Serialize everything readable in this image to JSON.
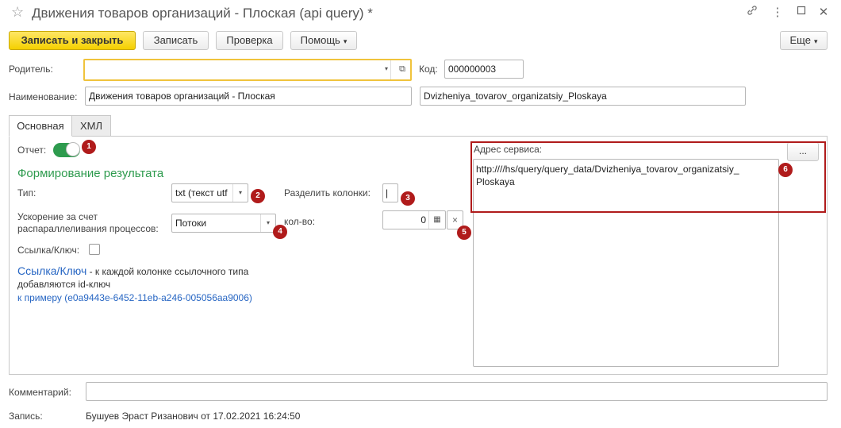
{
  "window": {
    "title": "Движения товаров организаций - Плоская (api query) *",
    "star_icon": "☆",
    "link_icon": "🔗",
    "menu_icon": "⋮",
    "min_icon": "▫",
    "close_icon": "✕"
  },
  "toolbar": {
    "save_close": "Записать и закрыть",
    "save": "Записать",
    "check": "Проверка",
    "help": "Помощь",
    "more": "Еще"
  },
  "header": {
    "parent_label": "Родитель:",
    "parent_value": "",
    "code_label": "Код:",
    "code_value": "000000003",
    "name_label": "Наименование:",
    "name_value": "Движения товаров организаций - Плоская",
    "name_translit": "Dvizheniya_tovarov_organizatsiy_Ploskaya"
  },
  "tabs": [
    {
      "label": "Основная",
      "active": true
    },
    {
      "label": "ХМЛ",
      "active": false
    }
  ],
  "main": {
    "report_label": "Отчет:",
    "report_on": true,
    "section_title": "Формирование результата",
    "type_label": "Тип:",
    "type_value": "txt (текст utf",
    "split_label": "Разделить колонки:",
    "split_value": "|",
    "accel_label_1": "Ускорение за счет",
    "accel_label_2": "распараллеливания процессов:",
    "accel_value": "Потоки",
    "count_label": "кол-во:",
    "count_value": "0",
    "refkey_label": "Ссылка/Ключ:",
    "refkey_checked": false,
    "refkey_link": "Ссылка/Ключ",
    "refkey_desc_1": " - к каждой колонке ссылочного типа",
    "refkey_desc_2": "добавляются id-ключ",
    "refkey_example": "к примеру (e0a9443e-6452-11eb-a246-005056aa9006)",
    "service_label": "Адрес сервиса:",
    "service_btn": "...",
    "service_value": "http:////hs/query/query_data/Dvizheniya_tovarov_organizatsiy_Ploskaya",
    "service_line1": "http:////hs/query/query_data/Dvizheniya_tovarov_organizatsiy_",
    "service_line2": "Ploskaya"
  },
  "badges": [
    "1",
    "2",
    "3",
    "4",
    "5",
    "6"
  ],
  "footer": {
    "comment_label": "Комментарий:",
    "comment_value": "",
    "record_label": "Запись:",
    "record_value": "Бушуев Эраст Ризанович от 17.02.2021 16:24:50"
  },
  "colors": {
    "accent_green": "#2e9b4e",
    "badge_red": "#b01b1b",
    "highlight_red": "#b01b1b",
    "link_blue": "#2766c3",
    "primary_yellow": "#f5d000"
  }
}
